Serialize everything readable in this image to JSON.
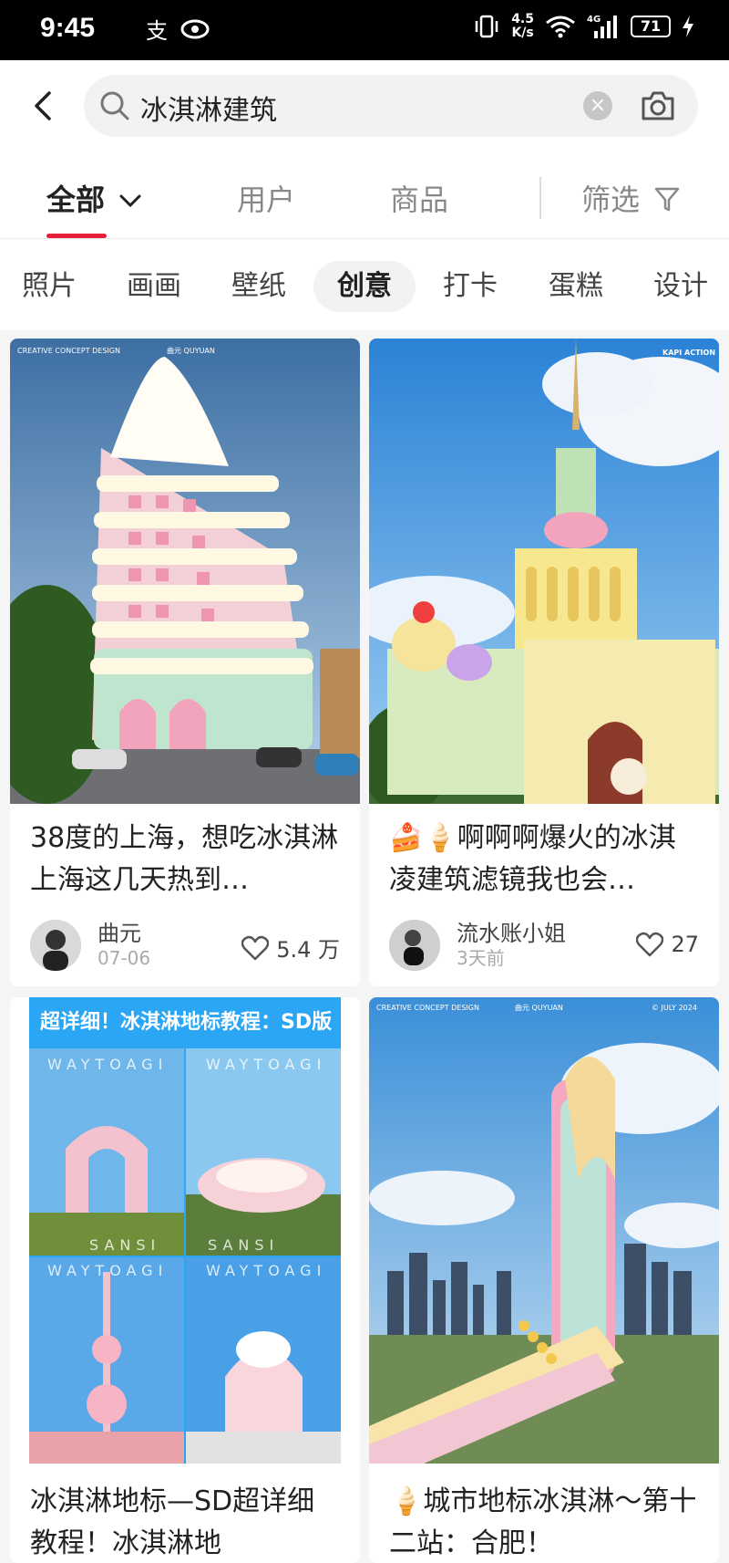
{
  "status": {
    "time": "9:45",
    "speed_value": "4.5",
    "speed_unit": "K/s",
    "network": "4G",
    "battery": "71"
  },
  "search": {
    "query": "冰淇淋建筑"
  },
  "tabs": [
    {
      "label": "全部"
    },
    {
      "label": "用户"
    },
    {
      "label": "商品"
    },
    {
      "label": "筛选"
    }
  ],
  "categories": [
    "照片",
    "画画",
    "壁纸",
    "创意",
    "打卡",
    "蛋糕",
    "设计"
  ],
  "posts": [
    {
      "title": "38度的上海，想吃冰淇淋 上海这几天热到…",
      "author": "曲元",
      "date": "07-06",
      "likes": "5.4 万",
      "tag_tl": "CREATIVE CONCEPT DESIGN",
      "tag_tc": "曲元 QUYUAN"
    },
    {
      "title": "🍰🍦啊啊啊爆火的冰淇凌建筑滤镜我也会…",
      "author": "流水账小姐",
      "date": "3天前",
      "likes": "27",
      "tag_tr": "KAPI ACTION"
    },
    {
      "title": "冰淇淋地标—SD超详细教程！冰淇淋地",
      "banner": "超详细！冰淇淋地标教程：SD版",
      "watermark": "WAYTOAGI",
      "watermark_bottom": "SANSI"
    },
    {
      "title": "🍦城市地标冰淇淋～第十二站：合肥！",
      "tag_tl": "CREATIVE CONCEPT DESIGN",
      "tag_tc": "曲元 QUYUAN",
      "tag_tr": "© JULY 2024"
    }
  ]
}
